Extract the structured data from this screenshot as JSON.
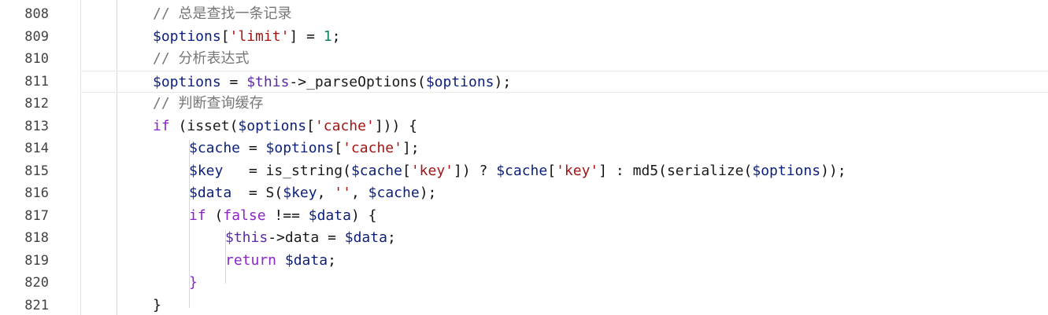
{
  "editor": {
    "language": "php",
    "current_line": 811,
    "lines": [
      {
        "num": 808,
        "indent": 2,
        "tokens": [
          {
            "t": "// 总是查找一条记录",
            "c": "comment"
          }
        ]
      },
      {
        "num": 809,
        "indent": 2,
        "tokens": [
          {
            "t": "$options",
            "c": "var"
          },
          {
            "t": "[",
            "c": "op"
          },
          {
            "t": "'limit'",
            "c": "str"
          },
          {
            "t": "] = ",
            "c": "op"
          },
          {
            "t": "1",
            "c": "num"
          },
          {
            "t": ";",
            "c": "op"
          }
        ]
      },
      {
        "num": 810,
        "indent": 2,
        "tokens": [
          {
            "t": "// 分析表达式",
            "c": "comment"
          }
        ]
      },
      {
        "num": 811,
        "indent": 2,
        "tokens": [
          {
            "t": "$options",
            "c": "var"
          },
          {
            "t": " = ",
            "c": "op"
          },
          {
            "t": "$this",
            "c": "this"
          },
          {
            "t": "->",
            "c": "op"
          },
          {
            "t": "_parseOptions",
            "c": "fn"
          },
          {
            "t": "(",
            "c": "op"
          },
          {
            "t": "$options",
            "c": "var"
          },
          {
            "t": ");",
            "c": "op"
          }
        ]
      },
      {
        "num": 812,
        "indent": 2,
        "tokens": [
          {
            "t": "// 判断查询缓存",
            "c": "comment"
          }
        ]
      },
      {
        "num": 813,
        "indent": 2,
        "tokens": [
          {
            "t": "if",
            "c": "kw"
          },
          {
            "t": " (",
            "c": "op"
          },
          {
            "t": "isset",
            "c": "fn"
          },
          {
            "t": "(",
            "c": "op"
          },
          {
            "t": "$options",
            "c": "var"
          },
          {
            "t": "[",
            "c": "op"
          },
          {
            "t": "'cache'",
            "c": "str"
          },
          {
            "t": "])) {",
            "c": "op"
          }
        ]
      },
      {
        "num": 814,
        "indent": 3,
        "tokens": [
          {
            "t": "$cache",
            "c": "var"
          },
          {
            "t": " = ",
            "c": "op"
          },
          {
            "t": "$options",
            "c": "var"
          },
          {
            "t": "[",
            "c": "op"
          },
          {
            "t": "'cache'",
            "c": "str"
          },
          {
            "t": "];",
            "c": "op"
          }
        ]
      },
      {
        "num": 815,
        "indent": 3,
        "tokens": [
          {
            "t": "$key",
            "c": "var"
          },
          {
            "t": "   = ",
            "c": "op"
          },
          {
            "t": "is_string",
            "c": "fn"
          },
          {
            "t": "(",
            "c": "op"
          },
          {
            "t": "$cache",
            "c": "var"
          },
          {
            "t": "[",
            "c": "op"
          },
          {
            "t": "'key'",
            "c": "str"
          },
          {
            "t": "]) ? ",
            "c": "op"
          },
          {
            "t": "$cache",
            "c": "var"
          },
          {
            "t": "[",
            "c": "op"
          },
          {
            "t": "'key'",
            "c": "str"
          },
          {
            "t": "] : ",
            "c": "op"
          },
          {
            "t": "md5",
            "c": "fn"
          },
          {
            "t": "(",
            "c": "op"
          },
          {
            "t": "serialize",
            "c": "fn"
          },
          {
            "t": "(",
            "c": "op"
          },
          {
            "t": "$options",
            "c": "var"
          },
          {
            "t": "));",
            "c": "op"
          }
        ]
      },
      {
        "num": 816,
        "indent": 3,
        "tokens": [
          {
            "t": "$data",
            "c": "var"
          },
          {
            "t": "  = ",
            "c": "op"
          },
          {
            "t": "S",
            "c": "fn"
          },
          {
            "t": "(",
            "c": "op"
          },
          {
            "t": "$key",
            "c": "var"
          },
          {
            "t": ", ",
            "c": "op"
          },
          {
            "t": "''",
            "c": "str"
          },
          {
            "t": ", ",
            "c": "op"
          },
          {
            "t": "$cache",
            "c": "var"
          },
          {
            "t": ");",
            "c": "op"
          }
        ]
      },
      {
        "num": 817,
        "indent": 3,
        "tokens": [
          {
            "t": "if",
            "c": "kw"
          },
          {
            "t": " (",
            "c": "op"
          },
          {
            "t": "false",
            "c": "kw"
          },
          {
            "t": " !== ",
            "c": "op"
          },
          {
            "t": "$data",
            "c": "var"
          },
          {
            "t": ") {",
            "c": "op"
          }
        ]
      },
      {
        "num": 818,
        "indent": 4,
        "tokens": [
          {
            "t": "$this",
            "c": "this"
          },
          {
            "t": "->",
            "c": "op"
          },
          {
            "t": "data",
            "c": "fn"
          },
          {
            "t": " = ",
            "c": "op"
          },
          {
            "t": "$data",
            "c": "var"
          },
          {
            "t": ";",
            "c": "op"
          }
        ]
      },
      {
        "num": 819,
        "indent": 4,
        "tokens": [
          {
            "t": "return",
            "c": "kw"
          },
          {
            "t": " ",
            "c": "op"
          },
          {
            "t": "$data",
            "c": "var"
          },
          {
            "t": ";",
            "c": "op"
          }
        ]
      },
      {
        "num": 820,
        "indent": 3,
        "tokens": [
          {
            "t": "}",
            "c": "kw"
          }
        ]
      },
      {
        "num": 821,
        "indent": 2,
        "tokens": [
          {
            "t": "}",
            "c": "op"
          }
        ]
      }
    ]
  },
  "colors": {
    "background": "#ffffff",
    "line_number": "#424242",
    "comment": "#767676",
    "variable": "#0b1f7a",
    "string": "#a31515",
    "number": "#098658",
    "keyword": "#8a25c8"
  }
}
